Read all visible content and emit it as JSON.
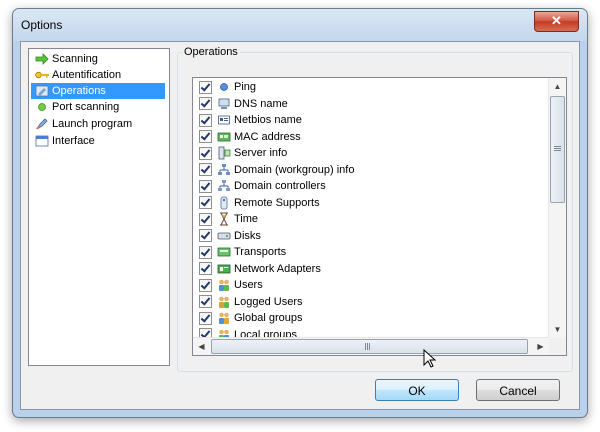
{
  "window": {
    "title": "Options",
    "close_symbol": "✕"
  },
  "sidebar": {
    "items": [
      {
        "label": "Scanning",
        "icon": "arrow-right-icon",
        "selected": false
      },
      {
        "label": "Autentification",
        "icon": "key-icon",
        "selected": false
      },
      {
        "label": "Operations",
        "icon": "operations-icon",
        "selected": true
      },
      {
        "label": "Port scanning",
        "icon": "green-dot-icon",
        "selected": false
      },
      {
        "label": "Launch program",
        "icon": "rocket-icon",
        "selected": false
      },
      {
        "label": "Interface",
        "icon": "window-icon",
        "selected": false
      }
    ]
  },
  "operations": {
    "group_label": "Operations",
    "items": [
      {
        "label": "Ping",
        "checked": true,
        "icon": "ping-dot-icon"
      },
      {
        "label": "DNS name",
        "checked": true,
        "icon": "computer-icon"
      },
      {
        "label": "Netbios name",
        "checked": true,
        "icon": "id-card-icon"
      },
      {
        "label": "MAC address",
        "checked": true,
        "icon": "network-card-icon"
      },
      {
        "label": "Server info",
        "checked": true,
        "icon": "server-icon"
      },
      {
        "label": "Domain (workgroup) info",
        "checked": true,
        "icon": "domain-icon"
      },
      {
        "label": "Domain controllers",
        "checked": true,
        "icon": "domain-controllers-icon"
      },
      {
        "label": "Remote Supports",
        "checked": true,
        "icon": "remote-icon"
      },
      {
        "label": "Time",
        "checked": true,
        "icon": "hourglass-icon"
      },
      {
        "label": "Disks",
        "checked": true,
        "icon": "disk-icon"
      },
      {
        "label": "Transports",
        "checked": true,
        "icon": "transport-card-icon"
      },
      {
        "label": "Network Adapters",
        "checked": true,
        "icon": "network-adapter-icon"
      },
      {
        "label": "Users",
        "checked": true,
        "icon": "users-icon"
      },
      {
        "label": "Logged Users",
        "checked": true,
        "icon": "logged-users-icon"
      },
      {
        "label": "Global groups",
        "checked": true,
        "icon": "global-groups-icon"
      },
      {
        "label": "Local groups",
        "checked": true,
        "icon": "local-groups-icon"
      }
    ]
  },
  "buttons": {
    "ok": "OK",
    "cancel": "Cancel"
  },
  "colors": {
    "selection": "#3399ff",
    "title_bar": "#c4d7ec",
    "close_button": "#c43c25"
  }
}
